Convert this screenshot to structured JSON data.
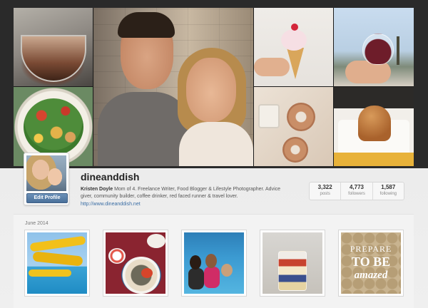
{
  "colors": {
    "accent": "#4a709a",
    "link": "#3b6ea5",
    "background_dark": "#2a2a2a",
    "background_light": "#efefef"
  },
  "cover": {
    "tiles": [
      {
        "name": "stand-mixer-photo"
      },
      {
        "name": "salad-photo"
      },
      {
        "name": "couple-selfie-photo"
      },
      {
        "name": "ice-cream-cone-photo"
      },
      {
        "name": "wine-glass-photo"
      },
      {
        "name": "donuts-photo"
      },
      {
        "name": "caramel-cake-photo"
      }
    ]
  },
  "profile": {
    "username": "dineanddish",
    "edit_profile_label": "Edit Profile",
    "full_name": "Kristen Doyle",
    "bio": "Mom of 4. Freelance Writer, Food Blogger & Lifestyle Photographer. Advice giver, community builder, coffee drinker, red faced runner & travel lover.",
    "website": "http://www.dineanddish.net",
    "stats": [
      {
        "count": "3,322",
        "label": "posts"
      },
      {
        "count": "4,773",
        "label": "followers"
      },
      {
        "count": "1,587",
        "label": "following"
      }
    ]
  },
  "feed": {
    "month": "June 2014",
    "photos": [
      {
        "name": "waterslide-photo"
      },
      {
        "name": "bagel-breakfast-photo"
      },
      {
        "name": "kids-pool-photo"
      },
      {
        "name": "parfait-jar-photo"
      },
      {
        "name": "prepare-to-be-amazed-photo",
        "text_lines": [
          "PREPARE",
          "TO BE",
          "amazed"
        ]
      }
    ]
  }
}
